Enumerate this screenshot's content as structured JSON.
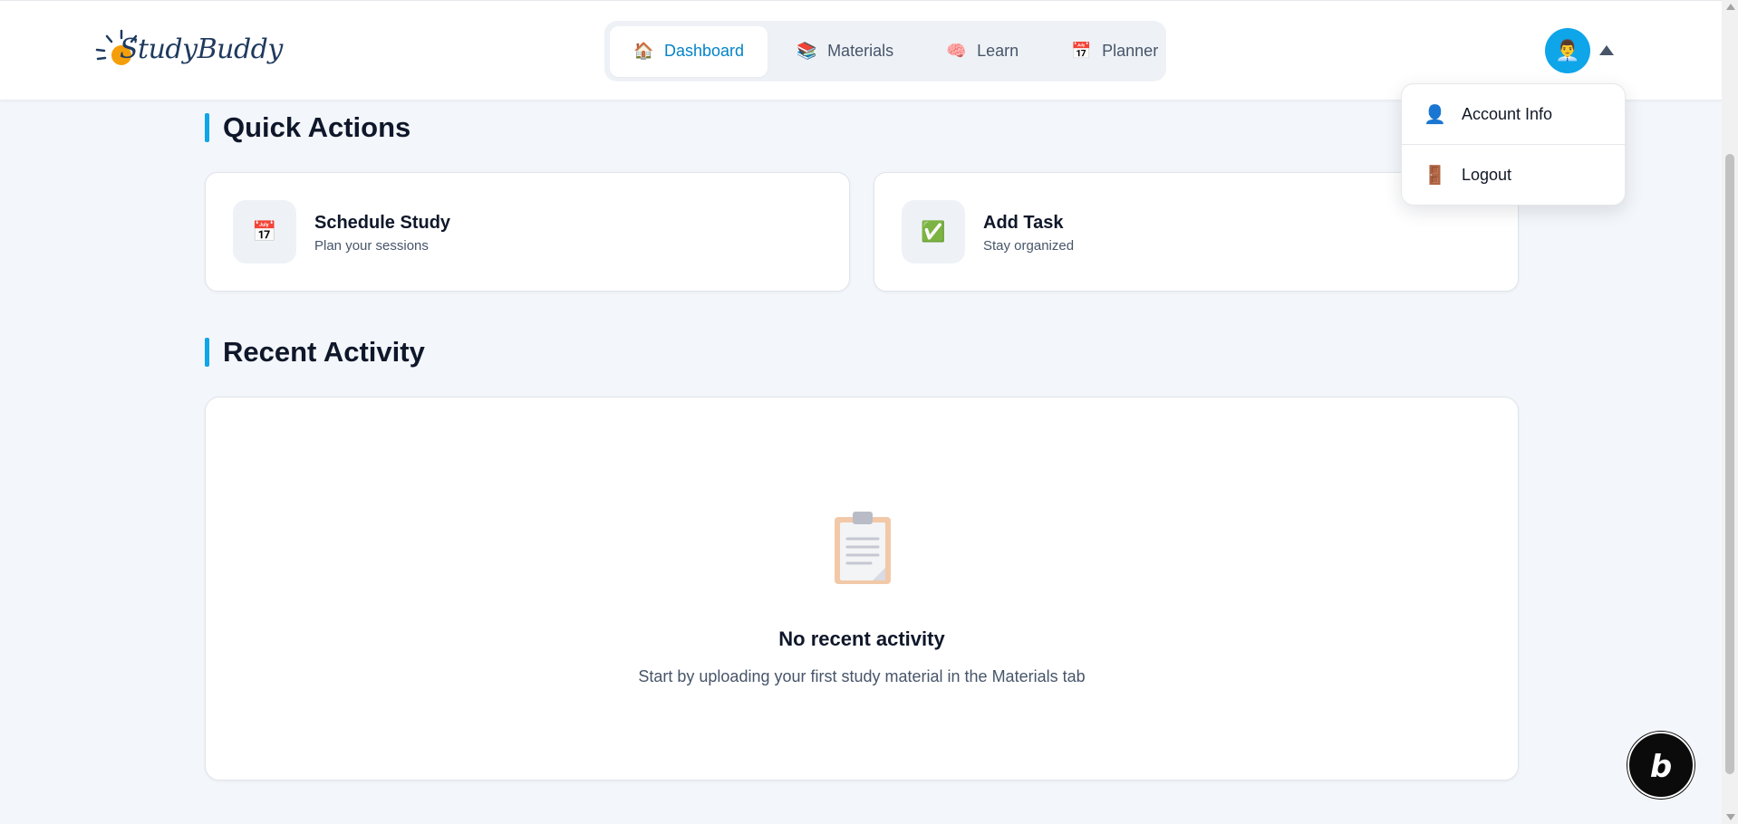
{
  "header": {
    "logo_text": "StudyBuddy",
    "nav": [
      {
        "label": "Dashboard",
        "icon": "🏠",
        "active": true
      },
      {
        "label": "Materials",
        "icon": "📚",
        "active": false
      },
      {
        "label": "Learn",
        "icon": "🧠",
        "active": false
      },
      {
        "label": "Planner",
        "icon": "📅",
        "active": false
      }
    ],
    "avatar_icon": "👨‍💼"
  },
  "dropdown": {
    "items": [
      {
        "label": "Account Info",
        "icon": "👤"
      },
      {
        "label": "Logout",
        "icon": "🚪"
      }
    ]
  },
  "quick_actions": {
    "title": "Quick Actions",
    "cards": [
      {
        "title": "Schedule Study",
        "subtitle": "Plan your sessions",
        "icon": "📅"
      },
      {
        "title": "Add Task",
        "subtitle": "Stay organized",
        "icon": "✅"
      }
    ]
  },
  "recent_activity": {
    "title": "Recent Activity",
    "empty_title": "No recent activity",
    "empty_subtitle": "Start by uploading your first study material in the Materials tab"
  },
  "badge": {
    "letter": "b"
  },
  "colors": {
    "accent": "#0ea5e9",
    "active_nav": "#0284c7",
    "background": "#f3f6fa"
  }
}
